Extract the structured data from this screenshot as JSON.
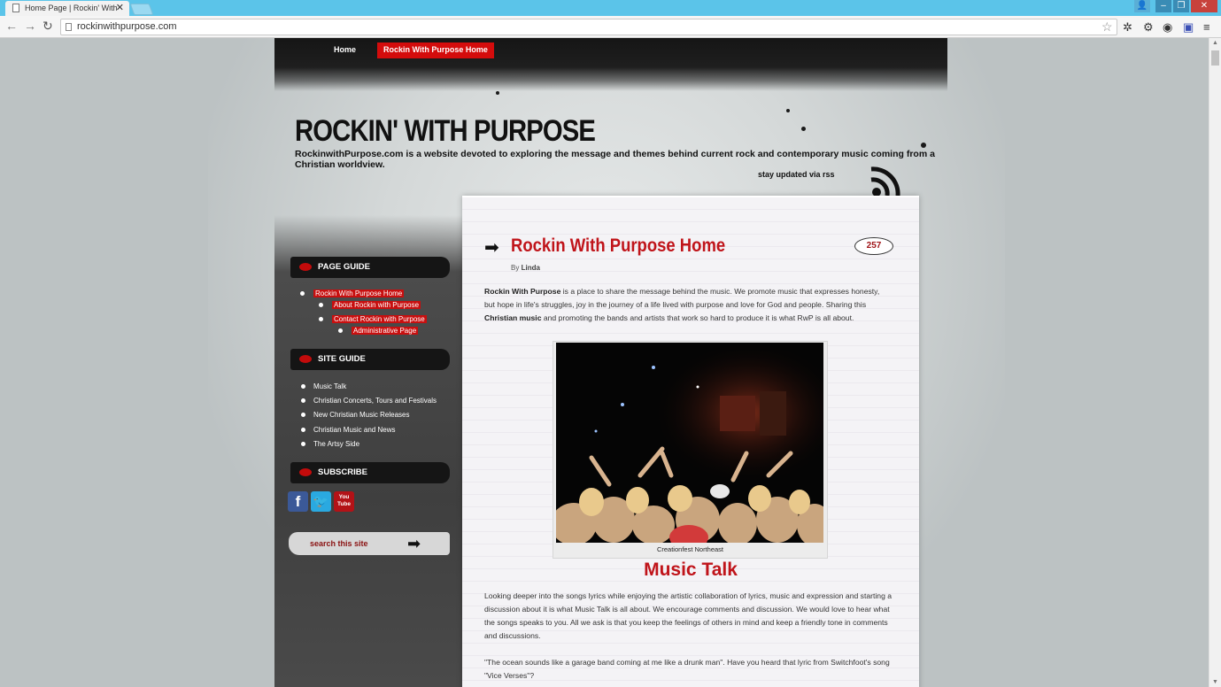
{
  "browser": {
    "tab_title": "Home Page | Rockin' With",
    "url": "rockinwithpurpose.com"
  },
  "nav": {
    "home": "Home",
    "rwp_home": "Rockin With Purpose Home"
  },
  "header": {
    "title": "ROCKIN' WITH PURPOSE",
    "description": "RockinwithPurpose.com is a website devoted to exploring the message and themes behind current rock and contemporary music coming from a Christian worldview.",
    "rss": "stay updated via rss"
  },
  "sidebar": {
    "page_guide": {
      "title": "PAGE GUIDE",
      "items": [
        "Rockin With Purpose Home",
        "About Rockin with Purpose",
        "Contact Rockin with Purpose",
        "Administrative Page"
      ]
    },
    "site_guide": {
      "title": "SITE GUIDE",
      "items": [
        "Music Talk",
        "Christian Concerts, Tours and Festivals",
        "New Christian Music Releases",
        "Christian Music and News",
        "The Artsy Side"
      ]
    },
    "subscribe": {
      "title": "SUBSCRIBE",
      "youtube_top": "You",
      "youtube_bottom": "Tube"
    },
    "search_placeholder": "search this site"
  },
  "post": {
    "title": "Rockin With Purpose Home",
    "comments": "257",
    "by_label": "By",
    "author": "Linda",
    "intro_bold1": "Rockin With Purpose",
    "intro_text1": " is a place to share the message behind the music. We promote music that expresses honesty, but hope in life's struggles, joy in the journey of a life lived with purpose and love for God and people.  Sharing this ",
    "intro_bold2": "Christian music",
    "intro_text2": " and promoting the bands and artists that work so hard to produce it is what RwP is all about.",
    "image_caption": "Creationfest Northeast",
    "section_title": "Music Talk",
    "section_text": "Looking deeper into the songs lyrics while enjoying the artistic collaboration of lyrics, music and expression and starting a discussion about it is what Music Talk is all about. We encourage comments and discussion. We would love to hear what the songs speaks to you. All we ask is that you keep the feelings of others in mind and keep a friendly tone in comments and discussions.",
    "quote_text": "\"The ocean sounds like a garage band coming at me like a drunk man\". Have you heard that lyric from Switchfoot's song \"Vice Verses\"?"
  },
  "colors": {
    "accent_red": "#c0141a",
    "titlebar": "#5bc4e9"
  }
}
